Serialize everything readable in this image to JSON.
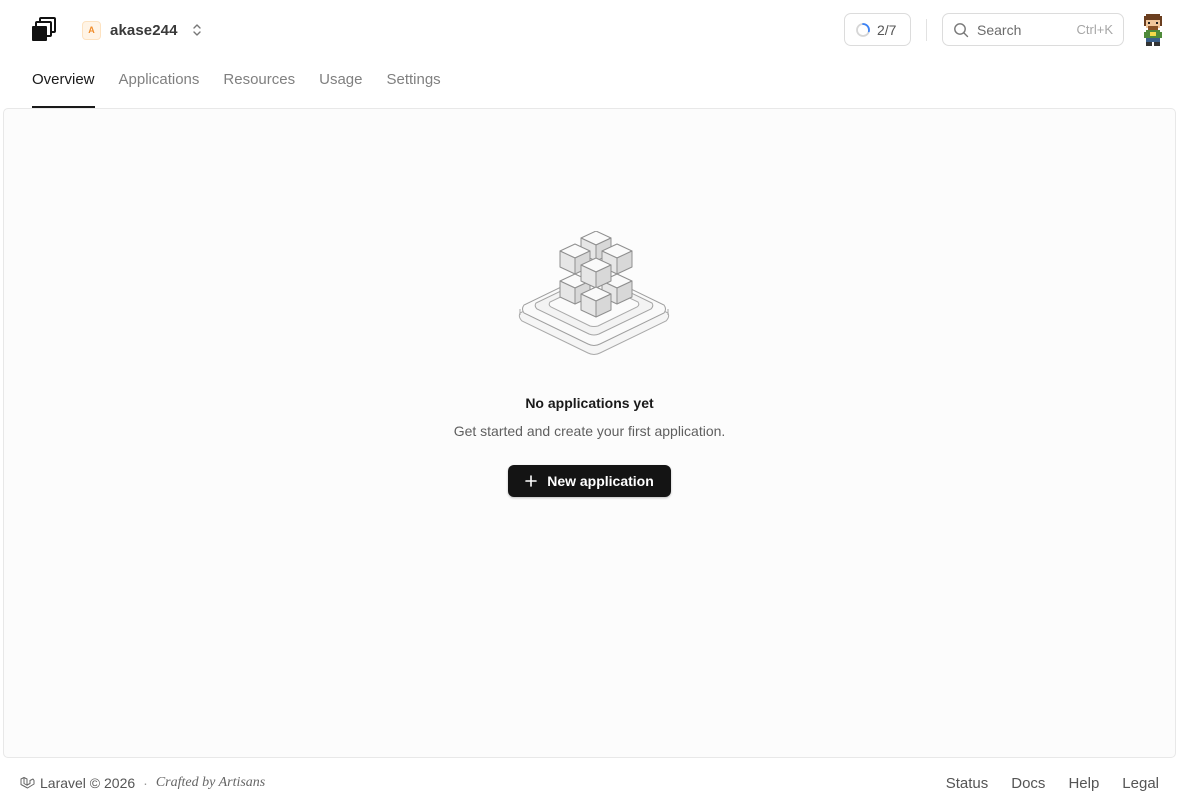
{
  "header": {
    "logo_icon": "stacked-squares-logo-icon",
    "team": {
      "initial": "A",
      "name": "akase244",
      "accent": "#f08c2a"
    },
    "progress": {
      "label": "2/7",
      "completed": 2,
      "total": 7
    },
    "search": {
      "placeholder": "Search",
      "shortcut": "Ctrl+K"
    },
    "avatar_icon": "pixel-avatar-icon"
  },
  "tabs": [
    {
      "label": "Overview",
      "active": true
    },
    {
      "label": "Applications",
      "active": false
    },
    {
      "label": "Resources",
      "active": false
    },
    {
      "label": "Usage",
      "active": false
    },
    {
      "label": "Settings",
      "active": false
    }
  ],
  "empty_state": {
    "illustration_icon": "isometric-cubes-icon",
    "title": "No applications yet",
    "subtitle": "Get started and create your first application.",
    "button_label": "New application"
  },
  "footer": {
    "brand": "Laravel © 2026",
    "separator": "·",
    "crafted": "Crafted by Artisans",
    "links": [
      "Status",
      "Docs",
      "Help",
      "Legal"
    ]
  },
  "colors": {
    "primary_button": "#141414",
    "panel_background": "#fcfcfc",
    "active_tab": "#1a1a1a",
    "progress_ring": "#3b82f6"
  }
}
